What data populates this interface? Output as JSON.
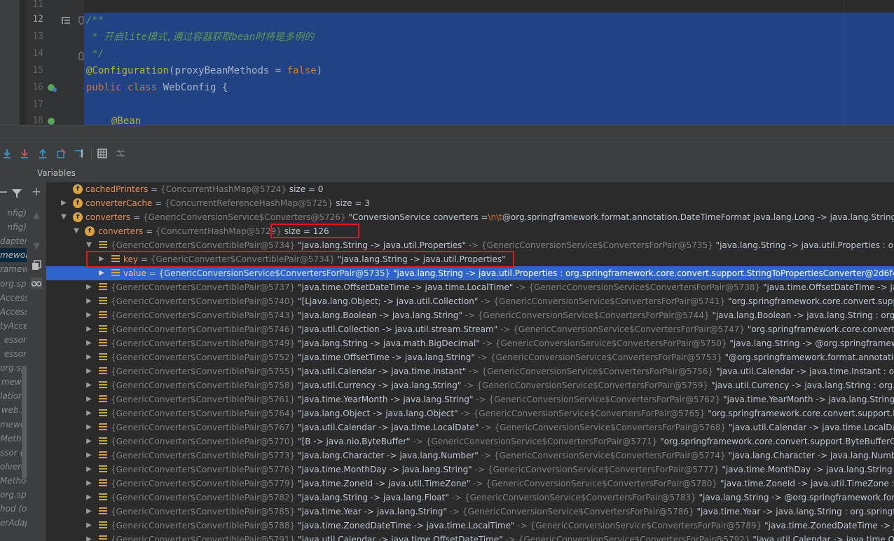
{
  "editor": {
    "lines": [
      {
        "num": "11"
      },
      {
        "num": "12"
      },
      {
        "num": "13",
        "text": " * 开启lite模式,通过容器获取bean时将是多例的"
      },
      {
        "num": "14",
        "text": " */"
      },
      {
        "num": "15",
        "ann": "@Configuration",
        "p1": "(proxyBeanMethods = ",
        "kw": "false",
        "p2": ")"
      },
      {
        "num": "16",
        "kw1": "public class ",
        "id": "WebConfig {"
      },
      {
        "num": "17"
      },
      {
        "num": "18",
        "ann": "@Bean"
      }
    ],
    "line12_text": "/**"
  },
  "variables": {
    "title": "Variables",
    "rows": [
      {
        "name": "cachedPrinters",
        "type": "{ConcurrentHashMap@5724}",
        "value": "size = 0"
      },
      {
        "name": "converterCache",
        "type": "{ConcurrentReferenceHashMap@5725}",
        "value": "size = 3"
      },
      {
        "name": "converters",
        "type": "{GenericConversionService$Converters@5726}",
        "value_pre": "\"ConversionService converters =",
        "value_esc": "\\n\\t",
        "value_post": "@org.springframework.format.annotation.DateTimeFormat java.lang.Long -> java.lang.String: org.springframework.format.datetime.DateTimeFormatAnnotationFormatterFactory@5a0bef24"
      },
      {
        "name": "converters",
        "type": "{ConcurrentHashMap@5729}",
        "value": "size = 126"
      },
      {
        "type": "{GenericConverter$ConvertiblePair@5734}",
        "value": "\"java.lang.String -> java.util.Properties\"",
        "arrow": "->",
        "type2": "{GenericConversionService$ConvertersForPair@5735}",
        "value2": "\"java.lang.String -> java.util.Properties : org.springframework.core.convert.support.StringToPropertiesConverter@2d6f4b88\""
      },
      {
        "name": "key",
        "type": "{GenericConverter$ConvertiblePair@5734}",
        "value": "\"java.lang.String -> java.util.Properties\""
      },
      {
        "name": "value",
        "type": "{GenericConversionService$ConvertersForPair@5735}",
        "value": "\"java.lang.String -> java.util.Properties : org.springframework.core.convert.support.StringToPropertiesConverter@2d6f4b88\""
      }
    ],
    "entries": [
      {
        "t1": "{GenericConverter$ConvertiblePair@5737}",
        "v1": "\"java.time.OffsetDateTime -> java.time.LocalTime\"",
        "t2": "{GenericConversionService$ConvertersForPair@5738}",
        "v2": "\"java.time.OffsetDateTime -> java.time.LocalTime : org.springframework"
      },
      {
        "t1": "{GenericConverter$ConvertiblePair@5740}",
        "v1": "\"[Ljava.lang.Object; -> java.util.Collection\"",
        "t2": "{GenericConversionService$ConvertersForPair@5741}",
        "v2": "\"org.springframework.core.convert.support.ArrayToCollectionConverter"
      },
      {
        "t1": "{GenericConverter$ConvertiblePair@5743}",
        "v1": "\"java.lang.Boolean -> java.lang.String\"",
        "t2": "{GenericConversionService$ConvertersForPair@5744}",
        "v2": "\"java.lang.Boolean -> java.lang.String : org.springframework.core"
      },
      {
        "t1": "{GenericConverter$ConvertiblePair@5746}",
        "v1": "\"java.util.Collection -> java.util.stream.Stream\"",
        "t2": "{GenericConversionService$ConvertersForPair@5747}",
        "v2": "\"org.springframework.core.convert.support.StreamConverter"
      },
      {
        "t1": "{GenericConverter$ConvertiblePair@5749}",
        "v1": "\"java.lang.String -> java.math.BigDecimal\"",
        "t2": "{GenericConversionService$ConvertersForPair@5750}",
        "v2": "\"java.lang.String -> @org.springframework.format.annotation"
      },
      {
        "t1": "{GenericConverter$ConvertiblePair@5752}",
        "v1": "\"java.time.OffsetTime -> java.lang.String\"",
        "t2": "{GenericConversionService$ConvertersForPair@5753}",
        "v2": "\"@org.springframework.format.annotation.DateTimeFormat"
      },
      {
        "t1": "{GenericConverter$ConvertiblePair@5755}",
        "v1": "\"java.util.Calendar -> java.time.Instant\"",
        "t2": "{GenericConversionService$ConvertersForPair@5756}",
        "v2": "\"java.util.Calendar -> java.time.Instant : org.springframework"
      },
      {
        "t1": "{GenericConverter$ConvertiblePair@5758}",
        "v1": "\"java.util.Currency -> java.lang.String\"",
        "t2": "{GenericConversionService$ConvertersForPair@5759}",
        "v2": "\"java.util.Currency -> java.lang.String : org.springframework"
      },
      {
        "t1": "{GenericConverter$ConvertiblePair@5761}",
        "v1": "\"java.time.YearMonth -> java.lang.String\"",
        "t2": "{GenericConversionService$ConvertersForPair@5762}",
        "v2": "\"java.time.YearMonth -> java.lang.String : org.springframework"
      },
      {
        "t1": "{GenericConverter$ConvertiblePair@5764}",
        "v1": "\"java.lang.Object -> java.lang.Object\"",
        "t2": "{GenericConversionService$ConvertersForPair@5765}",
        "v2": "\"org.springframework.core.convert.support.IdToEntityConverter"
      },
      {
        "t1": "{GenericConverter$ConvertiblePair@5767}",
        "v1": "\"java.util.Calendar -> java.time.LocalDate\"",
        "t2": "{GenericConversionService$ConvertersForPair@5768}",
        "v2": "\"java.util.Calendar -> java.time.LocalDate : org.springframework"
      },
      {
        "t1": "{GenericConverter$ConvertiblePair@5770}",
        "v1": "\"[B -> java.nio.ByteBuffer\"",
        "t2": "{GenericConversionService$ConvertersForPair@5771}",
        "v2": "\"org.springframework.core.convert.support.ByteBufferConverter@"
      },
      {
        "t1": "{GenericConverter$ConvertiblePair@5773}",
        "v1": "\"java.lang.Character -> java.lang.Number\"",
        "t2": "{GenericConversionService$ConvertersForPair@5774}",
        "v2": "\"java.lang.Character -> java.lang.Number : org.springframework"
      },
      {
        "t1": "{GenericConverter$ConvertiblePair@5776}",
        "v1": "\"java.time.MonthDay -> java.lang.String\"",
        "t2": "{GenericConversionService$ConvertersForPair@5777}",
        "v2": "\"java.time.MonthDay -> java.lang.String : org.springframework"
      },
      {
        "t1": "{GenericConverter$ConvertiblePair@5779}",
        "v1": "\"java.time.ZoneId -> java.util.TimeZone\"",
        "t2": "{GenericConversionService$ConvertersForPair@5780}",
        "v2": "\"java.time.ZoneId -> java.util.TimeZone : org.springframework"
      },
      {
        "t1": "{GenericConverter$ConvertiblePair@5782}",
        "v1": "\"java.lang.String -> java.lang.Float\"",
        "t2": "{GenericConversionService$ConvertersForPair@5783}",
        "v2": "\"java.lang.String -> @org.springframework.format.annotation"
      },
      {
        "t1": "{GenericConverter$ConvertiblePair@5785}",
        "v1": "\"java.time.Year -> java.lang.String\"",
        "t2": "{GenericConversionService$ConvertersForPair@5786}",
        "v2": "\"java.time.Year -> java.lang.String : org.springframework"
      },
      {
        "t1": "{GenericConverter$ConvertiblePair@5788}",
        "v1": "\"java.time.ZonedDateTime -> java.time.LocalTime\"",
        "t2": "{GenericConversionService$ConvertersForPair@5789}",
        "v2": "\"java.time.ZonedDateTime -> java.time.LocalTime : org.springframework"
      },
      {
        "t1": "{GenericConverter$ConvertiblePair@5791}",
        "v1": "\"java.util.Calendar -> java.time.OffsetDateTime\"",
        "t2": "{GenericConversionService$ConvertersForPair@5792}",
        "v2": "\"java.util.Calendar -> java.time.OffsetDateTime"
      }
    ]
  },
  "frames": [
    "nfig)",
    "nfig)",
    "dapter",
    "mewor",
    "ramew",
    "org.spri",
    "Accesso",
    "Accesso",
    "tyAcces",
    "essor",
    "essor",
    "org.spri",
    "mewo",
    "lation)",
    "web.b",
    "mewor",
    "Metho",
    "ssor (o",
    "olverC",
    "Method",
    "org.spri",
    "hod (o",
    "erAdap"
  ],
  "colors": {
    "selection": "#2f65ca",
    "highlight": "#e8141b"
  }
}
